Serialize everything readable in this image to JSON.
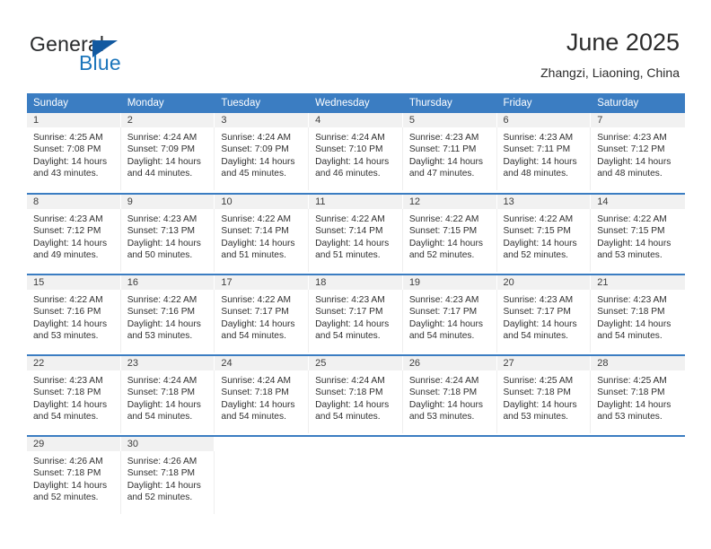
{
  "brand": {
    "name_part1": "General",
    "name_part2": "Blue",
    "triangle_icon": "triangle-icon",
    "accent_color": "#1b75bb"
  },
  "header": {
    "title": "June 2025",
    "subtitle": "Zhangzi, Liaoning, China"
  },
  "theme": {
    "header_blue": "#3b7dc2",
    "daynum_gray": "#f1f1f1",
    "text": "#303030"
  },
  "weekday_headers": [
    "Sunday",
    "Monday",
    "Tuesday",
    "Wednesday",
    "Thursday",
    "Friday",
    "Saturday"
  ],
  "weeks": [
    [
      {
        "day": "1",
        "sunrise": "Sunrise: 4:25 AM",
        "sunset": "Sunset: 7:08 PM",
        "daylight_line1": "Daylight: 14 hours",
        "daylight_line2": "and 43 minutes."
      },
      {
        "day": "2",
        "sunrise": "Sunrise: 4:24 AM",
        "sunset": "Sunset: 7:09 PM",
        "daylight_line1": "Daylight: 14 hours",
        "daylight_line2": "and 44 minutes."
      },
      {
        "day": "3",
        "sunrise": "Sunrise: 4:24 AM",
        "sunset": "Sunset: 7:09 PM",
        "daylight_line1": "Daylight: 14 hours",
        "daylight_line2": "and 45 minutes."
      },
      {
        "day": "4",
        "sunrise": "Sunrise: 4:24 AM",
        "sunset": "Sunset: 7:10 PM",
        "daylight_line1": "Daylight: 14 hours",
        "daylight_line2": "and 46 minutes."
      },
      {
        "day": "5",
        "sunrise": "Sunrise: 4:23 AM",
        "sunset": "Sunset: 7:11 PM",
        "daylight_line1": "Daylight: 14 hours",
        "daylight_line2": "and 47 minutes."
      },
      {
        "day": "6",
        "sunrise": "Sunrise: 4:23 AM",
        "sunset": "Sunset: 7:11 PM",
        "daylight_line1": "Daylight: 14 hours",
        "daylight_line2": "and 48 minutes."
      },
      {
        "day": "7",
        "sunrise": "Sunrise: 4:23 AM",
        "sunset": "Sunset: 7:12 PM",
        "daylight_line1": "Daylight: 14 hours",
        "daylight_line2": "and 48 minutes."
      }
    ],
    [
      {
        "day": "8",
        "sunrise": "Sunrise: 4:23 AM",
        "sunset": "Sunset: 7:12 PM",
        "daylight_line1": "Daylight: 14 hours",
        "daylight_line2": "and 49 minutes."
      },
      {
        "day": "9",
        "sunrise": "Sunrise: 4:23 AM",
        "sunset": "Sunset: 7:13 PM",
        "daylight_line1": "Daylight: 14 hours",
        "daylight_line2": "and 50 minutes."
      },
      {
        "day": "10",
        "sunrise": "Sunrise: 4:22 AM",
        "sunset": "Sunset: 7:14 PM",
        "daylight_line1": "Daylight: 14 hours",
        "daylight_line2": "and 51 minutes."
      },
      {
        "day": "11",
        "sunrise": "Sunrise: 4:22 AM",
        "sunset": "Sunset: 7:14 PM",
        "daylight_line1": "Daylight: 14 hours",
        "daylight_line2": "and 51 minutes."
      },
      {
        "day": "12",
        "sunrise": "Sunrise: 4:22 AM",
        "sunset": "Sunset: 7:15 PM",
        "daylight_line1": "Daylight: 14 hours",
        "daylight_line2": "and 52 minutes."
      },
      {
        "day": "13",
        "sunrise": "Sunrise: 4:22 AM",
        "sunset": "Sunset: 7:15 PM",
        "daylight_line1": "Daylight: 14 hours",
        "daylight_line2": "and 52 minutes."
      },
      {
        "day": "14",
        "sunrise": "Sunrise: 4:22 AM",
        "sunset": "Sunset: 7:15 PM",
        "daylight_line1": "Daylight: 14 hours",
        "daylight_line2": "and 53 minutes."
      }
    ],
    [
      {
        "day": "15",
        "sunrise": "Sunrise: 4:22 AM",
        "sunset": "Sunset: 7:16 PM",
        "daylight_line1": "Daylight: 14 hours",
        "daylight_line2": "and 53 minutes."
      },
      {
        "day": "16",
        "sunrise": "Sunrise: 4:22 AM",
        "sunset": "Sunset: 7:16 PM",
        "daylight_line1": "Daylight: 14 hours",
        "daylight_line2": "and 53 minutes."
      },
      {
        "day": "17",
        "sunrise": "Sunrise: 4:22 AM",
        "sunset": "Sunset: 7:17 PM",
        "daylight_line1": "Daylight: 14 hours",
        "daylight_line2": "and 54 minutes."
      },
      {
        "day": "18",
        "sunrise": "Sunrise: 4:23 AM",
        "sunset": "Sunset: 7:17 PM",
        "daylight_line1": "Daylight: 14 hours",
        "daylight_line2": "and 54 minutes."
      },
      {
        "day": "19",
        "sunrise": "Sunrise: 4:23 AM",
        "sunset": "Sunset: 7:17 PM",
        "daylight_line1": "Daylight: 14 hours",
        "daylight_line2": "and 54 minutes."
      },
      {
        "day": "20",
        "sunrise": "Sunrise: 4:23 AM",
        "sunset": "Sunset: 7:17 PM",
        "daylight_line1": "Daylight: 14 hours",
        "daylight_line2": "and 54 minutes."
      },
      {
        "day": "21",
        "sunrise": "Sunrise: 4:23 AM",
        "sunset": "Sunset: 7:18 PM",
        "daylight_line1": "Daylight: 14 hours",
        "daylight_line2": "and 54 minutes."
      }
    ],
    [
      {
        "day": "22",
        "sunrise": "Sunrise: 4:23 AM",
        "sunset": "Sunset: 7:18 PM",
        "daylight_line1": "Daylight: 14 hours",
        "daylight_line2": "and 54 minutes."
      },
      {
        "day": "23",
        "sunrise": "Sunrise: 4:24 AM",
        "sunset": "Sunset: 7:18 PM",
        "daylight_line1": "Daylight: 14 hours",
        "daylight_line2": "and 54 minutes."
      },
      {
        "day": "24",
        "sunrise": "Sunrise: 4:24 AM",
        "sunset": "Sunset: 7:18 PM",
        "daylight_line1": "Daylight: 14 hours",
        "daylight_line2": "and 54 minutes."
      },
      {
        "day": "25",
        "sunrise": "Sunrise: 4:24 AM",
        "sunset": "Sunset: 7:18 PM",
        "daylight_line1": "Daylight: 14 hours",
        "daylight_line2": "and 54 minutes."
      },
      {
        "day": "26",
        "sunrise": "Sunrise: 4:24 AM",
        "sunset": "Sunset: 7:18 PM",
        "daylight_line1": "Daylight: 14 hours",
        "daylight_line2": "and 53 minutes."
      },
      {
        "day": "27",
        "sunrise": "Sunrise: 4:25 AM",
        "sunset": "Sunset: 7:18 PM",
        "daylight_line1": "Daylight: 14 hours",
        "daylight_line2": "and 53 minutes."
      },
      {
        "day": "28",
        "sunrise": "Sunrise: 4:25 AM",
        "sunset": "Sunset: 7:18 PM",
        "daylight_line1": "Daylight: 14 hours",
        "daylight_line2": "and 53 minutes."
      }
    ],
    [
      {
        "day": "29",
        "sunrise": "Sunrise: 4:26 AM",
        "sunset": "Sunset: 7:18 PM",
        "daylight_line1": "Daylight: 14 hours",
        "daylight_line2": "and 52 minutes."
      },
      {
        "day": "30",
        "sunrise": "Sunrise: 4:26 AM",
        "sunset": "Sunset: 7:18 PM",
        "daylight_line1": "Daylight: 14 hours",
        "daylight_line2": "and 52 minutes."
      },
      {
        "day": "",
        "sunrise": "",
        "sunset": "",
        "daylight_line1": "",
        "daylight_line2": ""
      },
      {
        "day": "",
        "sunrise": "",
        "sunset": "",
        "daylight_line1": "",
        "daylight_line2": ""
      },
      {
        "day": "",
        "sunrise": "",
        "sunset": "",
        "daylight_line1": "",
        "daylight_line2": ""
      },
      {
        "day": "",
        "sunrise": "",
        "sunset": "",
        "daylight_line1": "",
        "daylight_line2": ""
      },
      {
        "day": "",
        "sunrise": "",
        "sunset": "",
        "daylight_line1": "",
        "daylight_line2": ""
      }
    ]
  ]
}
